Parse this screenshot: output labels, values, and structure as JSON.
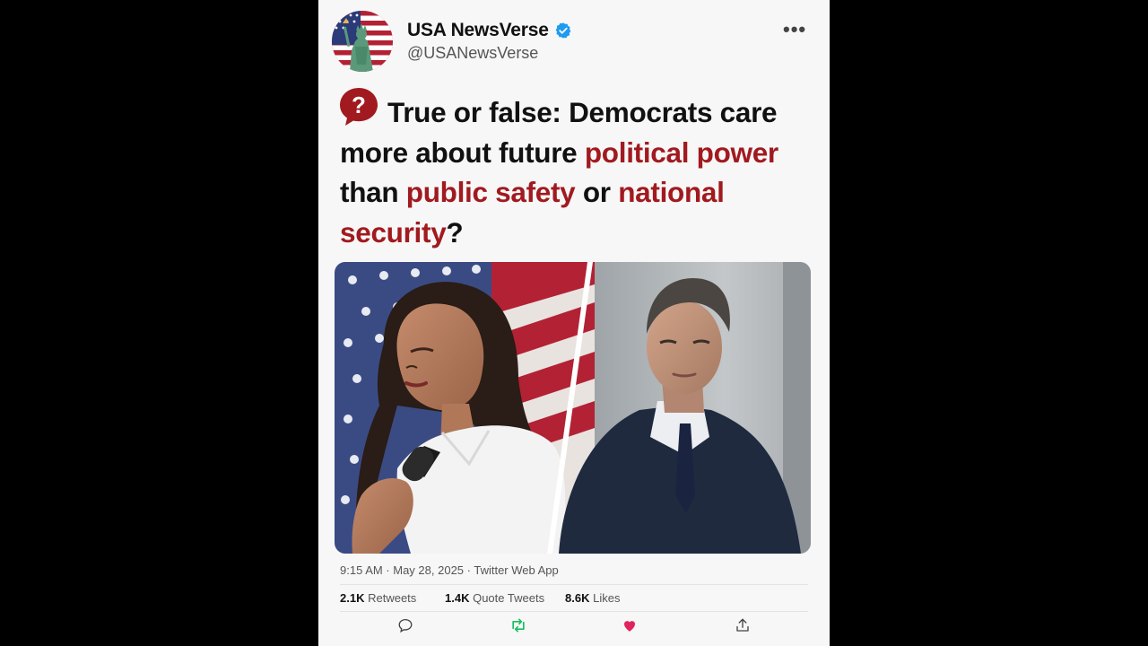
{
  "tweet": {
    "author": {
      "display_name": "USA NewsVerse",
      "handle": "@USANewsVerse",
      "verified": true
    },
    "headline": {
      "part1": "True or false: Democrats care more about future ",
      "hl1": "political power",
      "part2": " than ",
      "hl2": "public safety",
      "part3": " or ",
      "hl3": "national security",
      "part4": "?"
    },
    "meta": "9:15 AM · May 28, 2025 · Twitter Web App",
    "stats": {
      "retweets_count": "2.1K",
      "retweets_label": "Retweets",
      "quotes_count": "1.4K",
      "quotes_label": "Quote Tweets",
      "likes_count": "8.6K",
      "likes_label": "Likes"
    }
  },
  "colors": {
    "highlight": "#a11a1f",
    "verified": "#1d9bf0",
    "retweet": "#17bf63",
    "like": "#e0245e"
  },
  "icons": [
    "more-icon",
    "verified-icon",
    "question-icon",
    "reply-icon",
    "retweet-icon",
    "like-icon",
    "share-icon"
  ]
}
